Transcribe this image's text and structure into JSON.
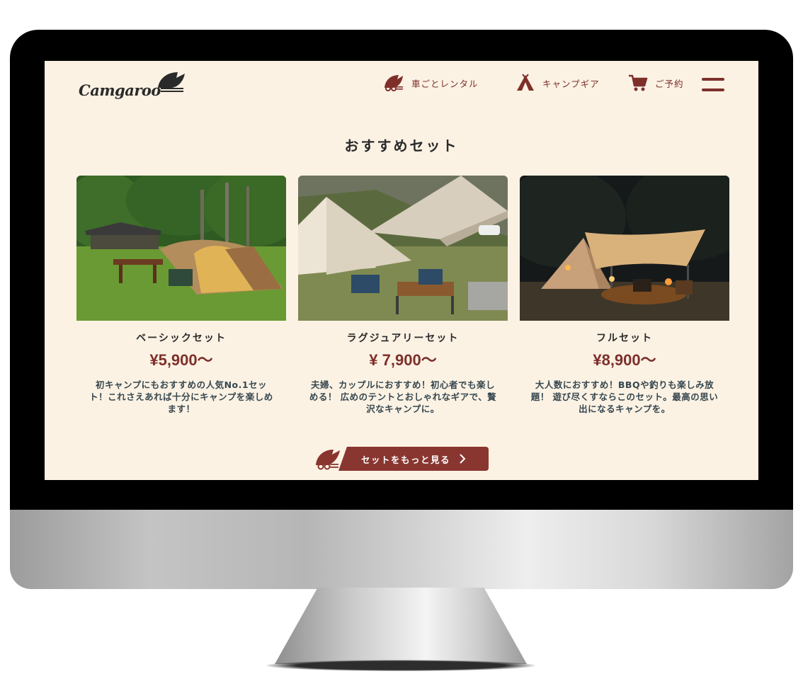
{
  "header": {
    "logo_text": "Camgaroo",
    "nav": [
      {
        "label": "車ごとレンタル",
        "icon": "camper-car-icon"
      },
      {
        "label": "キャンプギア",
        "icon": "tent-icon"
      },
      {
        "label": "ご予約",
        "icon": "cart-icon"
      }
    ],
    "menu_icon": "hamburger-menu-icon"
  },
  "section": {
    "title": "おすすめセット"
  },
  "cards": [
    {
      "name": "ベーシックセット",
      "price": "¥5,900〜",
      "desc": "初キャンプにもおすすめの人気No.1セット！これさえあれば十分にキャンプを楽しめます！",
      "photo": "tent-on-grass-photo"
    },
    {
      "name": "ラグジュアリーセット",
      "price": "¥ 7,900〜",
      "desc": "夫婦、カップルにおすすめ！初心者でも楽しめる！ 広めのテントとおしゃれなギアで、贅沢なキャンプに。",
      "photo": "luxury-bell-tent-photo"
    },
    {
      "name": "フルセット",
      "price": "¥8,900〜",
      "desc": "大人数におすすめ！BBQや釣りも楽しみ放題！ 遊び尽くすならこのセット。最高の思い出になるキャンプを。",
      "photo": "night-camp-photo"
    }
  ],
  "more_button": {
    "label": "セットをもっと見る",
    "icon": "chevron-right-icon"
  },
  "colors": {
    "background": "#fbf2e4",
    "accent": "#893630",
    "text": "#2a2a2a",
    "desc_text": "#37474f"
  }
}
